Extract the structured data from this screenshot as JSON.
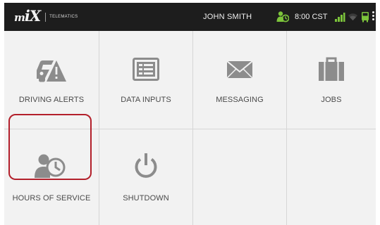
{
  "statusbar": {
    "logo_text": "MiX",
    "logo_subtitle": "TELEMATICS",
    "user_name": "JOHN SMITH",
    "time": "8:00 CST",
    "colors": {
      "background": "#1d1d1d",
      "ok_green": "#7cc43b"
    },
    "icons": [
      "hos-status-icon",
      "signal-icon",
      "wifi-icon",
      "vehicle-icon",
      "overflow-menu-icon"
    ]
  },
  "menu": {
    "tiles": [
      {
        "label": "DRIVING ALERTS",
        "icon": "car-warning-icon"
      },
      {
        "label": "DATA INPUTS",
        "icon": "form-list-icon"
      },
      {
        "label": "MESSAGING",
        "icon": "envelope-icon"
      },
      {
        "label": "JOBS",
        "icon": "briefcase-icon"
      },
      {
        "label": "HOURS OF SERVICE",
        "icon": "driver-clock-icon"
      },
      {
        "label": "SHUTDOWN",
        "icon": "power-icon"
      }
    ],
    "highlighted_tile": "HOURS OF SERVICE",
    "colors": {
      "icon_gray": "#8c8c8c",
      "highlight": "#b3202b",
      "tile_bg": "#f2f2f2"
    }
  }
}
